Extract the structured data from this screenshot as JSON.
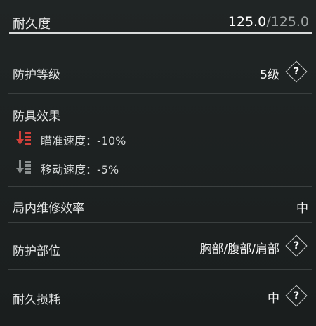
{
  "durability": {
    "label": "耐久度",
    "current": "125.0",
    "max": "/125.0",
    "fill_fraction": 1.0
  },
  "protection_level": {
    "label": "防护等级",
    "value": "5级",
    "help": "?"
  },
  "armor_effects": {
    "label": "防具效果",
    "items": [
      {
        "text": "瞄准速度：-10%",
        "icon": "red-decrease-icon",
        "color": "#d0403a"
      },
      {
        "text": "移动速度：-5%",
        "icon": "gray-decrease-icon",
        "color": "#8b9090"
      }
    ]
  },
  "repair_efficiency": {
    "label": "局内维修效率",
    "value": "中"
  },
  "protection_area": {
    "label": "防护部位",
    "value": "胸部/腹部/肩部",
    "help": "?"
  },
  "durability_loss": {
    "label": "耐久损耗",
    "value": "中",
    "help": "?"
  }
}
